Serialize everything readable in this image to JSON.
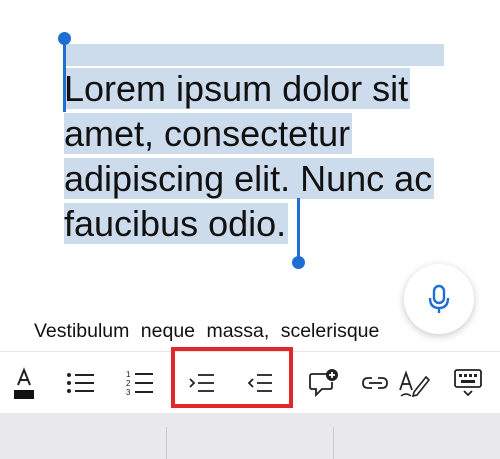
{
  "document": {
    "selected_text": "Lorem ipsum dolor sit amet, consectetur adipiscing elit. Nunc ac faucibus odio.",
    "next_line": "Vestibulum neque massa, scelerisque"
  },
  "colors": {
    "selection": "#cddcec",
    "handle": "#1e6fd1",
    "highlight_box": "#e3262a"
  },
  "toolbar": {
    "items": [
      {
        "icon": "font-color-icon"
      },
      {
        "icon": "bulleted-list-icon"
      },
      {
        "icon": "numbered-list-icon"
      },
      {
        "icon": "increase-indent-icon"
      },
      {
        "icon": "decrease-indent-icon"
      },
      {
        "icon": "insert-comment-icon"
      },
      {
        "icon": "link-icon"
      },
      {
        "icon": "pen-icon"
      },
      {
        "icon": "keyboard-icon"
      }
    ]
  },
  "dictate": {
    "icon": "microphone-icon"
  }
}
